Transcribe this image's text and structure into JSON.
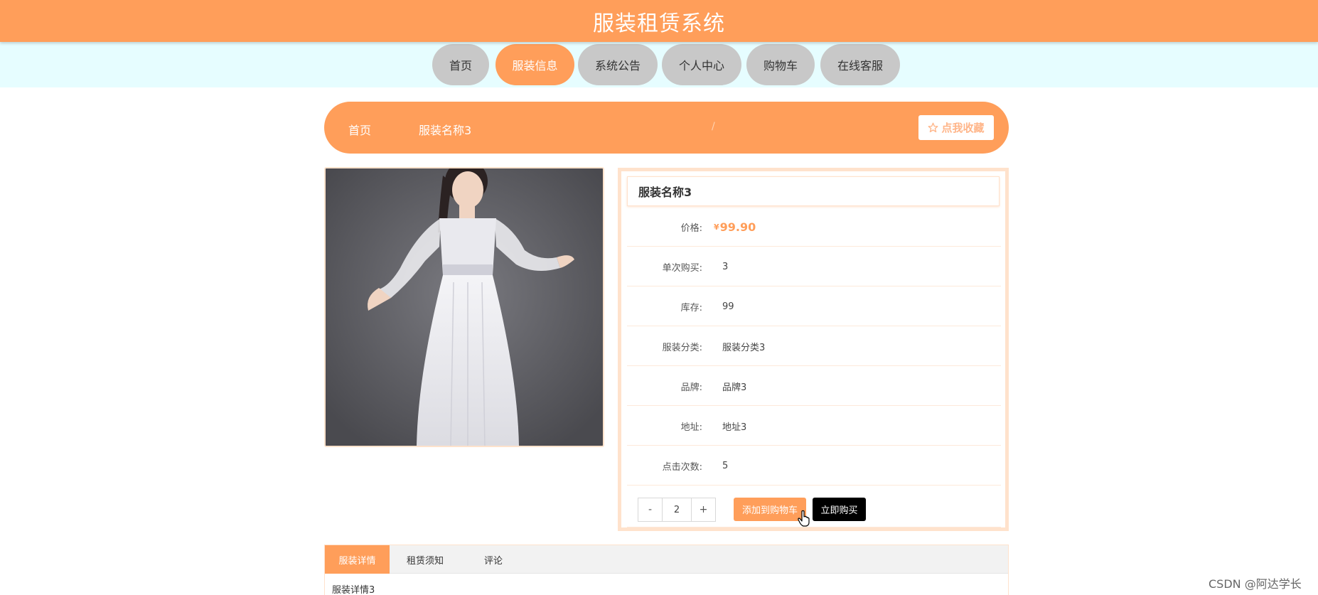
{
  "header": {
    "title": "服装租赁系统"
  },
  "nav": {
    "items": [
      {
        "label": "首页"
      },
      {
        "label": "服装信息",
        "active": true
      },
      {
        "label": "系统公告"
      },
      {
        "label": "个人中心"
      },
      {
        "label": "购物车"
      },
      {
        "label": "在线客服"
      }
    ]
  },
  "breadcrumb": {
    "home": "首页",
    "separator": "/",
    "current": "服装名称3",
    "favorite_label": "点我收藏"
  },
  "product": {
    "name": "服装名称3",
    "price_label": "价格:",
    "currency": "¥",
    "price": "99.90",
    "rows": [
      {
        "label": "单次购买:",
        "value": "3"
      },
      {
        "label": "库存:",
        "value": "99"
      },
      {
        "label": "服装分类:",
        "value": "服装分类3"
      },
      {
        "label": "品牌:",
        "value": "品牌3"
      },
      {
        "label": "地址:",
        "value": "地址3"
      },
      {
        "label": "点击次数:",
        "value": "5"
      }
    ],
    "quantity": "2",
    "minus_label": "-",
    "plus_label": "+",
    "add_to_cart_label": "添加到购物车",
    "buy_now_label": "立即购买"
  },
  "tabs": {
    "items": [
      {
        "label": "服装详情",
        "active": true
      },
      {
        "label": "租赁须知"
      },
      {
        "label": "评论"
      }
    ],
    "content": "服装详情3"
  },
  "watermark": "CSDN @阿达学长",
  "colors": {
    "accent": "#ff9e5a",
    "nav_bg": "#e6fdff",
    "nav_item": "#c8c8c8",
    "border_soft": "#ffe2cc"
  }
}
